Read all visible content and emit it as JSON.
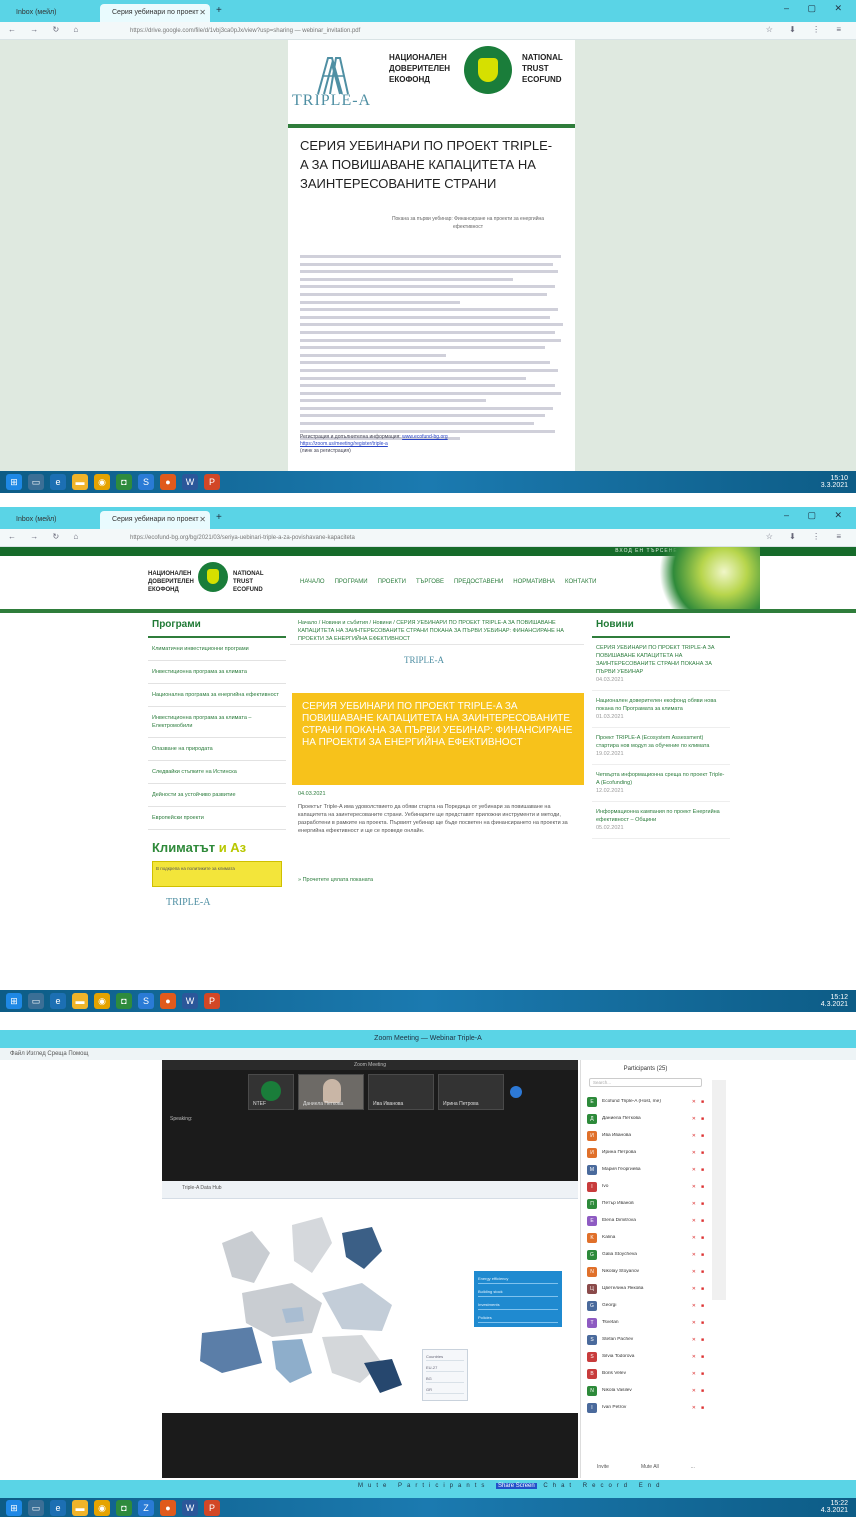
{
  "shot1": {
    "tabs": [
      {
        "label": "Іnbox (мейл)",
        "active": false
      },
      {
        "label": "Серия уебинари по проект",
        "active": true
      }
    ],
    "url": "https://drive.google.com/file/d/1vbj3ca0pJx/view?usp=sharing — webinar_invitation.pdf",
    "doc": {
      "logo_word": "TRIPLE-A",
      "ntef_bg": [
        "НАЦИОНАЛЕН",
        "ДОВЕРИТЕЛЕН",
        "ЕКОФОНД"
      ],
      "ntef_en": [
        "NATIONAL",
        "TRUST",
        "ECOFUND"
      ],
      "title": "СЕРИЯ УЕБИНАРИ ПО ПРОЕКТ TRIPLE-A ЗА ПОВИШАВАНЕ КАПАЦИТЕТА НА ЗАИНТЕРЕСОВАНИТЕ СТРАНИ",
      "subtitle": "Покана за първи уебинар: Финансиране на проекти за енергийна ефективност",
      "footer": [
        "Регистрация и допълнителна информация: ",
        "www.ecofund-bg.org",
        "https://zoom.us/meeting/register/triple-a",
        "(линк за регистрация)"
      ]
    },
    "taskbar_time": [
      "15:10",
      "3.3.2021"
    ]
  },
  "shot2": {
    "tabs": [
      {
        "label": "Іnbox (мейл)",
        "active": false
      },
      {
        "label": "Серия уебинари по проект",
        "active": true
      }
    ],
    "url": "https://ecofund-bg.org/bg/2021/03/seriya-uebinari-triple-a-za-povishavane-kapaciteta",
    "topstrip": "ВХОД  ЕН  ТЪРСЕНЕ  КАРТА НА САЙТА",
    "logo_bg": [
      "НАЦИОНАЛЕН",
      "ДОВЕРИТЕЛЕН",
      "ЕКОФОНД"
    ],
    "logo_en": [
      "NATIONAL",
      "TRUST",
      "ECOFUND"
    ],
    "menu": [
      "Начало",
      "Програми",
      "Проекти",
      "Търгове",
      "Предоставени",
      "Нормативна",
      "Контакти"
    ],
    "left_heading": "Програми",
    "left_items": [
      "Климатични инвестиционни програми",
      "Инвестиционна програма за климата",
      "Национална програма за енергийна ефективност",
      "Инвестиционна програма за климата – Електромобили",
      "Опазване на природата",
      "Следвайки стъпките на Истинска",
      "Дейности за устойчиво развитие",
      "Европейски проекти"
    ],
    "klimat": [
      "Климатът",
      " и Аз"
    ],
    "ybox": "В подкрепа на политиките за климата",
    "mini_logo": "TRIPLE-A",
    "breadcrumb": "Начало / Новини и събития / Новини / СЕРИЯ УЕБИНАРИ ПО ПРОЕКТ TRIPLE-A ЗА ПОВИШАВАНЕ КАПАЦИТЕТА НА ЗАИНТЕРЕСОВАНИТЕ СТРАНИ ПОКАНА ЗА ПЪРВИ УЕБИНАР: ФИНАНСИРАНЕ НА ПРОЕКТИ ЗА ЕНЕРГИЙНА ЕФЕКТИВНОСТ",
    "mid_logo": "TRIPLE-A",
    "headline": "СЕРИЯ УЕБИНАРИ ПО ПРОЕКТ TRIPLE-A ЗА ПОВИШАВАНЕ КАПАЦИТЕТА НА ЗАИНТЕРЕСОВАНИТЕ СТРАНИ ПОКАНА ЗА ПЪРВИ УЕБИНАР: ФИНАНСИРАНЕ НА ПРОЕКТИ ЗА ЕНЕРГИЙНА ЕФЕКТИВНОСТ",
    "date": "04.03.2021",
    "paragraph": "Проектът Triple-A има удоволствието да обяви старта на Поредица от уебинари за повишаване на капацитета на заинтересованите страни. Уебинарите ще представят приложни инструменти и методи, разработени в рамките на проекта. Първият уебинар ще бъде посветен на финансирането на проекти за енергийна ефективност и ще се проведе онлайн.",
    "more": "» Прочетете цялата поканата",
    "right_heading": "Новини",
    "news": [
      {
        "title": "СЕРИЯ УЕБИНАРИ ПО ПРОЕКТ TRIPLE-A ЗА ПОВИШАВАНЕ КАПАЦИТЕТА НА ЗАИНТЕРЕСОВАНИТЕ СТРАНИ ПОКАНА ЗА ПЪРВИ УЕБИНАР",
        "date": "04.03.2021"
      },
      {
        "title": "Национален доверителен екофонд обяви нова покана по Програмата за климата",
        "date": "01.03.2021"
      },
      {
        "title": "Проект TRIPLE-A (Ecosystem Assessment) стартира нов модул за обучение по климата",
        "date": "19.02.2021"
      },
      {
        "title": "Четвърта информационна среща по проект Triple-A (Ecofunding)",
        "date": "12.02.2021"
      },
      {
        "title": "Информационна кампания по проект Енергийна ефективност – Общини",
        "date": "05.02.2021"
      }
    ],
    "taskbar_time": [
      "15:12",
      "4.3.2021"
    ]
  },
  "shot3": {
    "title": "Zoom Meeting — Webinar Triple-A",
    "menu": "Файл   Изглед   Среща   Помощ",
    "meeting_header": "Zoom Meeting",
    "thumbs": [
      "NTEF",
      "Даниела Петкова",
      "Ива Иванова",
      "Ирина Петрова"
    ],
    "speaker": "Speaking:",
    "share_tab": "Triple-A Data Hub",
    "map_panel": [
      "Energy efficiency",
      "Building stock",
      "Investments",
      "Policies",
      "Financing"
    ],
    "map_box": [
      "Countries",
      "EU-27",
      "BG",
      "GR",
      "ES"
    ],
    "participants_heading": "Participants (25)",
    "search_placeholder": "Search...",
    "participants": [
      {
        "name": "Ecofund Triple-A (Host, me)",
        "color": "#2d8a3a"
      },
      {
        "name": "Даниела Петкова",
        "color": "#2d8a3a"
      },
      {
        "name": "Ива Иванова",
        "color": "#e0702a"
      },
      {
        "name": "Ирина Петрова",
        "color": "#e0702a"
      },
      {
        "name": "Мария Георгиева",
        "color": "#4a6a9c"
      },
      {
        "name": "Ivo",
        "color": "#c83c3c"
      },
      {
        "name": "Петър Иванов",
        "color": "#2d8a3a"
      },
      {
        "name": "Elena Dimitrova",
        "color": "#8e5bc2"
      },
      {
        "name": "Kalina",
        "color": "#e0702a"
      },
      {
        "name": "Galia Stoycheva",
        "color": "#2d8a3a"
      },
      {
        "name": "Nikolay Stoyanov",
        "color": "#e0702a"
      },
      {
        "name": "Цветелина Янкова",
        "color": "#8a4a4a"
      },
      {
        "name": "Georgi",
        "color": "#4a6a9c"
      },
      {
        "name": "Tsvetan",
        "color": "#8e5bc2"
      },
      {
        "name": "Stefan Pachev",
        "color": "#4a6a9c"
      },
      {
        "name": "Silvia Todorova",
        "color": "#c83c3c"
      },
      {
        "name": "Boris Velev",
        "color": "#c83c3c"
      },
      {
        "name": "Nikola Vasilev",
        "color": "#2d8a3a"
      },
      {
        "name": "Ivan Petrov",
        "color": "#4a6a9c"
      }
    ],
    "panel_footer": [
      "Invite",
      "Mute All",
      "..."
    ],
    "controls": [
      "Mute",
      "Participants",
      "Share Screen",
      "Chat",
      "Record",
      "End"
    ],
    "taskbar_time": [
      "15:22",
      "4.3.2021"
    ]
  }
}
